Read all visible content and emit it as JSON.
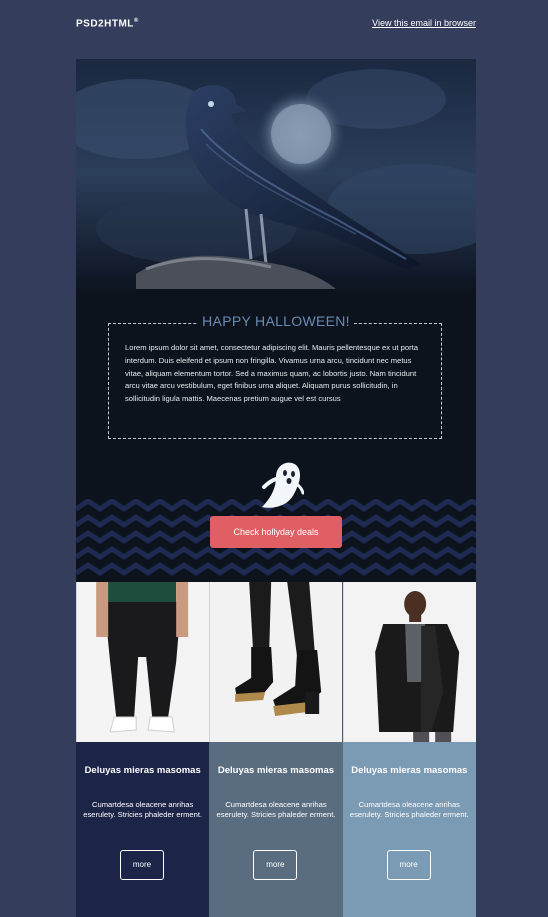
{
  "header": {
    "logo": "PSD2HTML",
    "logo_mark": "®",
    "view_link": "View this email in browser"
  },
  "hero": {
    "image": "raven-on-branch-night-sky-image"
  },
  "greeting": {
    "title": "HAPPY HALLOWEEN!",
    "body": "Lorem ipsum dolor sit amet, consectetur adipiscing elit. Mauris pellentesque ex ut porta interdum. Duis eleifend et ipsum non fringilla. Vivamus urna arcu, tincidunt nec metus vitae, aliquam elementum tortor. Sed a maximus quam, ac lobortis justo. Nam tincidunt arcu vitae arcu vestibulum, eget finibus urna aliquet. Aliquam purus sollicitudin, in sollicitudin ligula mattis. Maecenas pretium augue vel est cursus",
    "icon": "ghost-icon",
    "cta_label": "Check hollyday deals"
  },
  "products": [
    {
      "image": "man-black-joggers-white-sneakers-image",
      "title": "Deluyas mieras masomas",
      "description": "Cumartdesa oleacene anrihas eserulety. Stricies phaleder erment.",
      "button_label": "more",
      "color": "#1c2447"
    },
    {
      "image": "black-leather-boots-image",
      "title": "Deluyas mieras masomas",
      "description": "Cumartdesa oleacene anrihas eserulety. Stricies phaleder erment.",
      "button_label": "more",
      "color": "#5a6d80"
    },
    {
      "image": "man-black-leather-coat-image",
      "title": "Deluyas mieras masomas",
      "description": "Cumartdesa oleacene anrihas eserulety. Stricies phaleder erment.",
      "button_label": "more",
      "color": "#7b9ab3"
    }
  ],
  "colors": {
    "page_background": "#343d5c",
    "dark_section": "#0c131d",
    "title_blue": "#6b8ab3",
    "cta": "#e05f64",
    "zigzag": "#1f2a52"
  }
}
